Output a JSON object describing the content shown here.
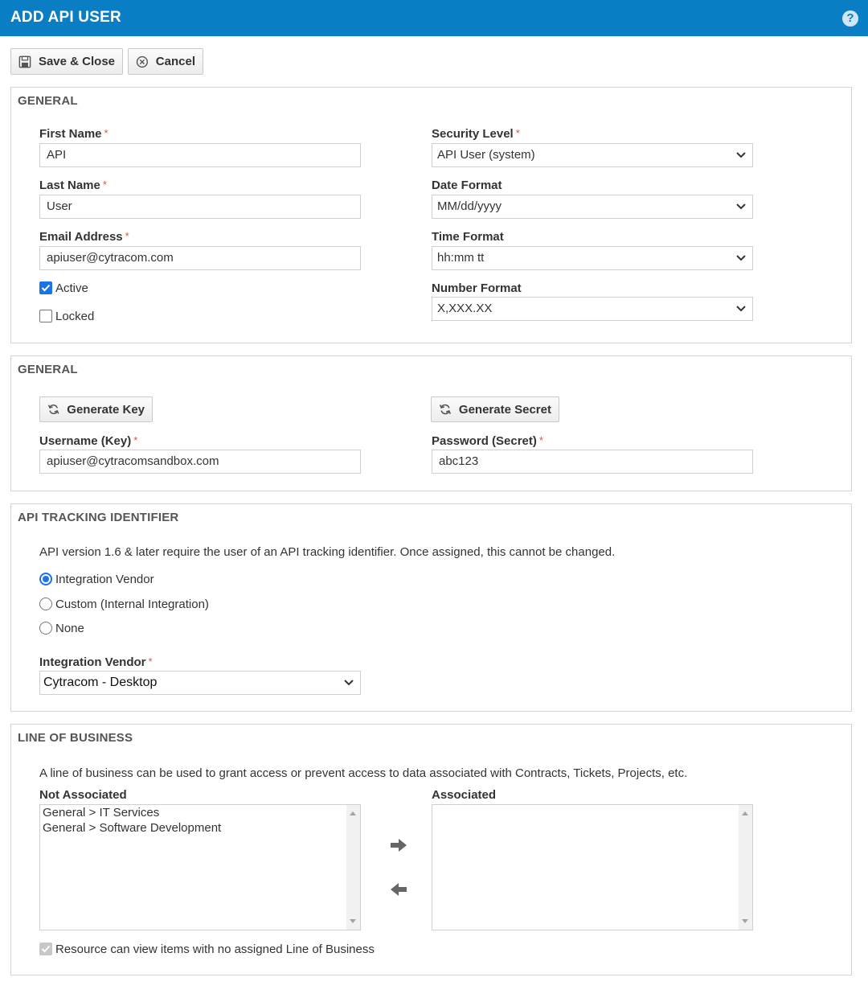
{
  "header": {
    "title": "ADD API USER",
    "help": "?"
  },
  "toolbar": {
    "save_close": "Save & Close",
    "cancel": "Cancel"
  },
  "general": {
    "section_title": "GENERAL",
    "first_name": {
      "label": "First Name",
      "value": "API"
    },
    "last_name": {
      "label": "Last Name",
      "value": "User"
    },
    "email": {
      "label": "Email Address",
      "value": "apiuser@cytracom.com"
    },
    "active": {
      "label": "Active",
      "checked": true
    },
    "locked": {
      "label": "Locked",
      "checked": false
    },
    "security_level": {
      "label": "Security Level",
      "value": "API User (system)"
    },
    "date_format": {
      "label": "Date Format",
      "value": "MM/dd/yyyy"
    },
    "time_format": {
      "label": "Time Format",
      "value": "hh:mm tt"
    },
    "number_format": {
      "label": "Number Format",
      "value": "X,XXX.XX"
    },
    "required_mark": "*"
  },
  "credentials": {
    "section_title": "GENERAL",
    "generate_key": "Generate Key",
    "generate_secret": "Generate Secret",
    "username": {
      "label": "Username (Key)",
      "value": "apiuser@cytracomsandbox.com"
    },
    "password": {
      "label": "Password (Secret)",
      "value": "abc123"
    }
  },
  "tracking": {
    "section_title": "API TRACKING IDENTIFIER",
    "description": "API version 1.6 & later require the user of an API tracking identifier. Once assigned, this cannot be changed.",
    "options": [
      {
        "label": "Integration Vendor",
        "selected": true
      },
      {
        "label": "Custom (Internal Integration)",
        "selected": false
      },
      {
        "label": "None",
        "selected": false
      }
    ],
    "vendor": {
      "label": "Integration Vendor",
      "value": "Cytracom - Desktop"
    }
  },
  "lob": {
    "section_title": "LINE OF BUSINESS",
    "description": "A line of business can be used to grant access or prevent access to data associated with Contracts, Tickets, Projects, etc.",
    "not_associated_label": "Not Associated",
    "associated_label": "Associated",
    "not_associated_items": [
      "General > IT Services",
      "General > Software Development"
    ],
    "associated_items": [],
    "no_lob_checkbox": {
      "label": "Resource can view items with no assigned Line of Business",
      "checked": true,
      "disabled": true
    }
  },
  "colors": {
    "header": "#0a7ec4",
    "accent": "#1a73e8",
    "required": "#d9534f"
  }
}
